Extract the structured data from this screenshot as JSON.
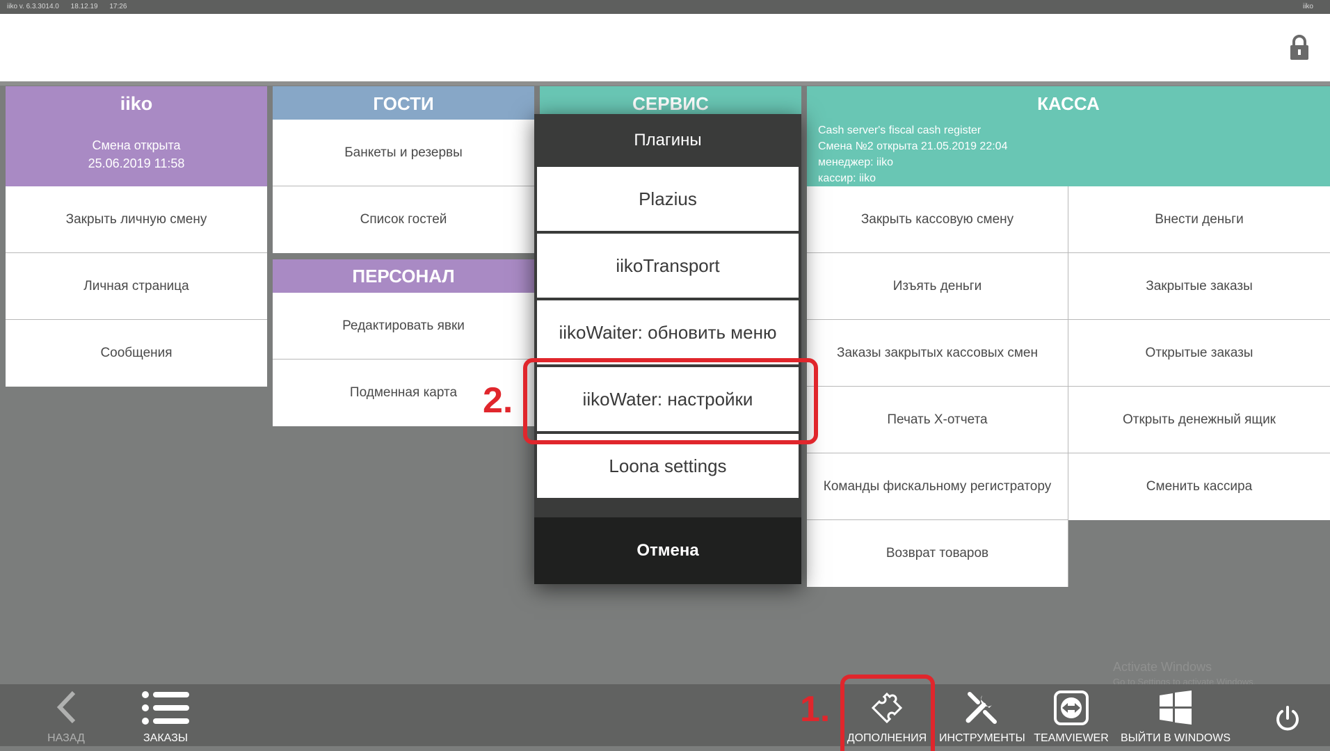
{
  "titlebar": {
    "version": "iiko v. 6.3.3014.0",
    "date": "18.12.19",
    "time": "17:26",
    "user": "iiko"
  },
  "header": {
    "lock_icon": "lock-icon"
  },
  "iiko": {
    "title": "iiko",
    "status": "Смена открыта",
    "opened": "25.06.2019 11:58",
    "items": [
      "Закрыть личную смену",
      "Личная страница",
      "Сообщения"
    ]
  },
  "guests": {
    "title": "ГОСТИ",
    "items": [
      "Банкеты и резервы",
      "Список гостей"
    ]
  },
  "staff": {
    "title": "ПЕРСОНАЛ",
    "items": [
      "Редактировать явки",
      "Подменная карта"
    ]
  },
  "service": {
    "title": "СЕРВИС"
  },
  "kassa": {
    "title": "КАССА",
    "info": [
      "Cash server's fiscal cash register",
      "Смена №2 открыта 21.05.2019 22:04",
      "менеджер: iiko",
      "кассир: iiko"
    ],
    "left_items": [
      "Закрыть кассовую смену",
      "Изъять деньги",
      "Заказы закрытых кассовых смен",
      "Печать X-отчета",
      "Команды фискальному регистратору",
      "Возврат товаров"
    ],
    "right_items": [
      "Внести деньги",
      "Закрытые заказы",
      "Открытые заказы",
      "Открыть денежный ящик",
      "Сменить кассира"
    ]
  },
  "plugins_dialog": {
    "title": "Плагины",
    "items": [
      "Plazius",
      "iikoTransport",
      "iikoWaiter: обновить меню",
      "iikoWater: настройки",
      "Loona settings"
    ],
    "cancel": "Отмена"
  },
  "annotations": {
    "step1": "1.",
    "step2": "2.",
    "color": "#e0262c"
  },
  "bottombar": {
    "back": "НАЗАД",
    "orders": "ЗАКАЗЫ",
    "addons": "ДОПОЛНЕНИЯ",
    "tools": "ИНСТРУМЕНТЫ",
    "teamviewer": "TEAMVIEWER",
    "windows": "ВЫЙТИ В WINDOWS"
  },
  "watermark": {
    "line1": "Activate Windows",
    "line2": "Go to Settings to activate Windows."
  }
}
